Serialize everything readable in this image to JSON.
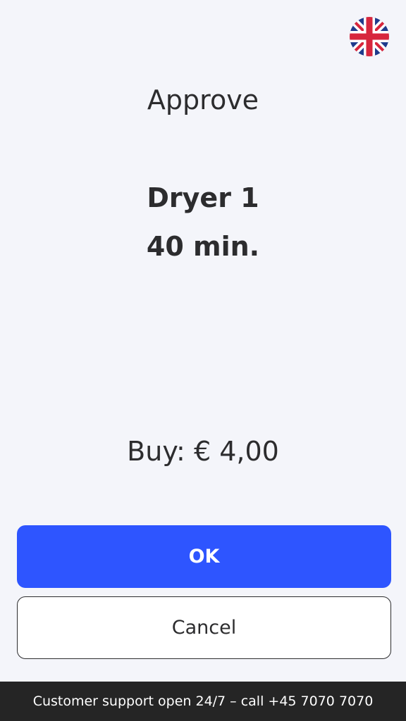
{
  "language": {
    "current_icon": "uk-flag-icon"
  },
  "dialog": {
    "title": "Approve",
    "machine_name": "Dryer 1",
    "duration": "40 min.",
    "price_label": "Buy:",
    "price_value": "€ 4,00"
  },
  "actions": {
    "ok_label": "OK",
    "cancel_label": "Cancel"
  },
  "footer": {
    "support_text": "Customer support open 24/7 – call +45 7070 7070"
  },
  "colors": {
    "background": "#f4f5fa",
    "primary_button": "#2e55ff",
    "footer_background": "#252525",
    "text": "#2c2c2e"
  }
}
